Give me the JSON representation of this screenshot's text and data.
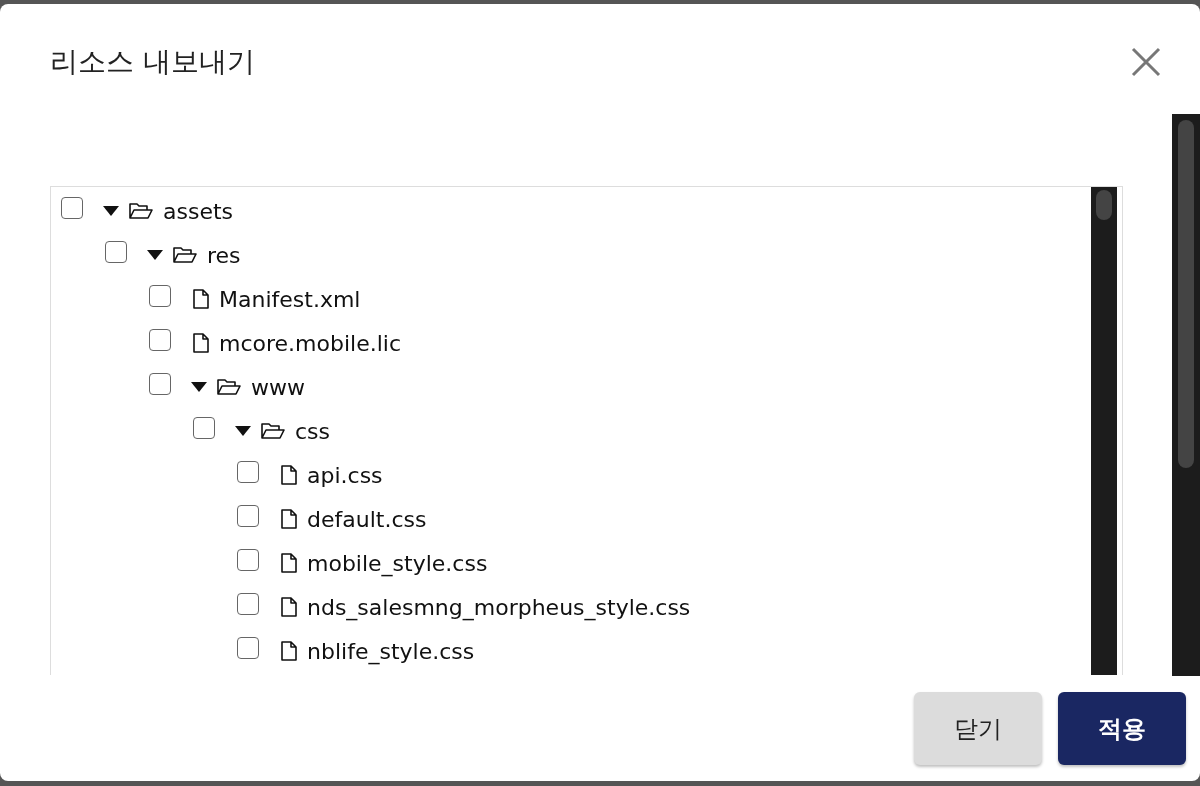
{
  "dialog": {
    "title": "리소스 내보내기",
    "tree": [
      {
        "kind": "folder",
        "label": "assets",
        "checked": false,
        "expanded": true,
        "children": [
          {
            "kind": "folder",
            "label": "res",
            "checked": false,
            "expanded": true,
            "children": [
              {
                "kind": "file",
                "label": "Manifest.xml",
                "checked": false
              },
              {
                "kind": "file",
                "label": "mcore.mobile.lic",
                "checked": false
              },
              {
                "kind": "folder",
                "label": "www",
                "checked": false,
                "expanded": true,
                "children": [
                  {
                    "kind": "folder",
                    "label": "css",
                    "checked": false,
                    "expanded": true,
                    "children": [
                      {
                        "kind": "file",
                        "label": "api.css",
                        "checked": false
                      },
                      {
                        "kind": "file",
                        "label": "default.css",
                        "checked": false
                      },
                      {
                        "kind": "file",
                        "label": "mobile_style.css",
                        "checked": false
                      },
                      {
                        "kind": "file",
                        "label": "nds_salesmng_morpheus_style.css",
                        "checked": false
                      },
                      {
                        "kind": "file",
                        "label": "nblife_style.css",
                        "checked": false
                      }
                    ]
                  }
                ]
              }
            ]
          }
        ]
      }
    ],
    "buttons": [
      {
        "kind": "secondary",
        "label": "닫기"
      },
      {
        "kind": "primary",
        "label": "적용"
      }
    ]
  }
}
